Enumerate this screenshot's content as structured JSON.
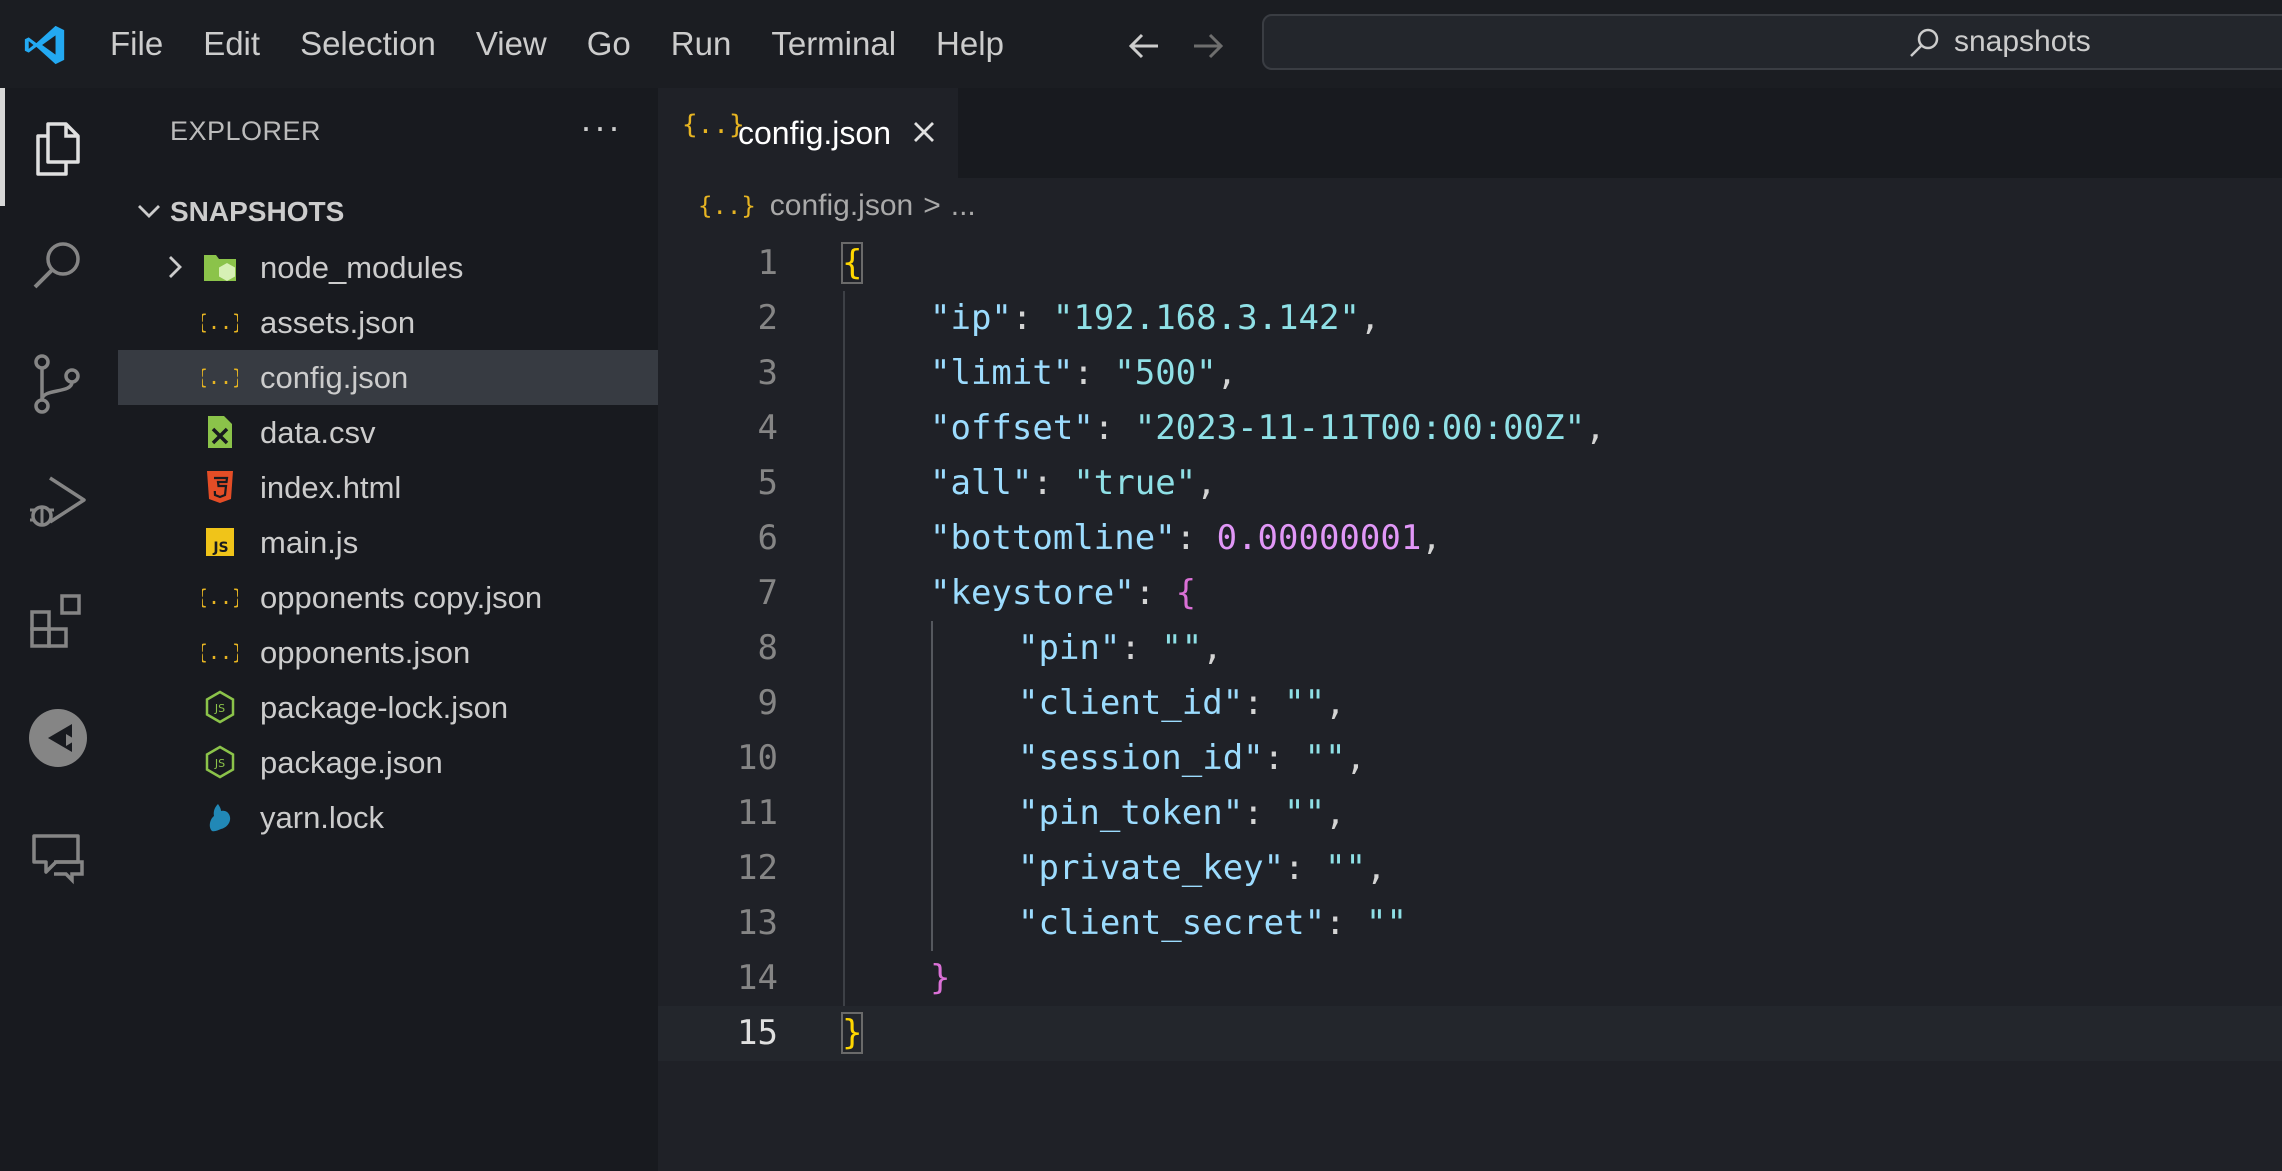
{
  "menu": {
    "items": [
      "File",
      "Edit",
      "Selection",
      "View",
      "Go",
      "Run",
      "Terminal",
      "Help"
    ]
  },
  "search": {
    "text": "snapshots"
  },
  "sidebar": {
    "title": "EXPLORER",
    "more": "···",
    "section": "SNAPSHOTS",
    "files": [
      {
        "name": "node_modules",
        "icon": "folder-node-icon",
        "type": "folder"
      },
      {
        "name": "assets.json",
        "icon": "json-icon"
      },
      {
        "name": "config.json",
        "icon": "json-icon",
        "selected": true
      },
      {
        "name": "data.csv",
        "icon": "csv-icon"
      },
      {
        "name": "index.html",
        "icon": "html5-icon"
      },
      {
        "name": "main.js",
        "icon": "js-icon"
      },
      {
        "name": "opponents copy.json",
        "icon": "json-icon"
      },
      {
        "name": "opponents.json",
        "icon": "json-icon"
      },
      {
        "name": "package-lock.json",
        "icon": "nodejs-icon"
      },
      {
        "name": "package.json",
        "icon": "nodejs-icon"
      },
      {
        "name": "yarn.lock",
        "icon": "yarn-icon"
      }
    ]
  },
  "editor": {
    "tab": {
      "label": "config.json",
      "icon_text": "{..}"
    },
    "breadcrumb": {
      "file": "config.json",
      "sep": ">",
      "rest": "...",
      "icon_text": "{..}"
    },
    "current_line": 15,
    "lines": [
      {
        "n": "1",
        "tokens": [
          [
            "b1",
            "{"
          ]
        ]
      },
      {
        "n": "2",
        "indent": 1,
        "tokens": [
          [
            "k",
            "\"ip\""
          ],
          [
            "p",
            ": "
          ],
          [
            "s",
            "\"192.168.3.142\""
          ],
          [
            "p",
            ","
          ]
        ]
      },
      {
        "n": "3",
        "indent": 1,
        "tokens": [
          [
            "k",
            "\"limit\""
          ],
          [
            "p",
            ": "
          ],
          [
            "s",
            "\"500\""
          ],
          [
            "p",
            ","
          ]
        ]
      },
      {
        "n": "4",
        "indent": 1,
        "tokens": [
          [
            "k",
            "\"offset\""
          ],
          [
            "p",
            ": "
          ],
          [
            "s",
            "\"2023-11-11T00:00:00Z\""
          ],
          [
            "p",
            ","
          ]
        ]
      },
      {
        "n": "5",
        "indent": 1,
        "tokens": [
          [
            "k",
            "\"all\""
          ],
          [
            "p",
            ": "
          ],
          [
            "s",
            "\"true\""
          ],
          [
            "p",
            ","
          ]
        ]
      },
      {
        "n": "6",
        "indent": 1,
        "tokens": [
          [
            "k",
            "\"bottomline\""
          ],
          [
            "p",
            ": "
          ],
          [
            "n",
            "0.00000001"
          ],
          [
            "p",
            ","
          ]
        ]
      },
      {
        "n": "7",
        "indent": 1,
        "tokens": [
          [
            "k",
            "\"keystore\""
          ],
          [
            "p",
            ": "
          ],
          [
            "b2",
            "{"
          ]
        ]
      },
      {
        "n": "8",
        "indent": 2,
        "tokens": [
          [
            "k",
            "\"pin\""
          ],
          [
            "p",
            ": "
          ],
          [
            "s",
            "\"\""
          ],
          [
            "p",
            ","
          ]
        ]
      },
      {
        "n": "9",
        "indent": 2,
        "tokens": [
          [
            "k",
            "\"client_id\""
          ],
          [
            "p",
            ": "
          ],
          [
            "s",
            "\"\""
          ],
          [
            "p",
            ","
          ]
        ]
      },
      {
        "n": "10",
        "indent": 2,
        "tokens": [
          [
            "k",
            "\"session_id\""
          ],
          [
            "p",
            ": "
          ],
          [
            "s",
            "\"\""
          ],
          [
            "p",
            ","
          ]
        ]
      },
      {
        "n": "11",
        "indent": 2,
        "tokens": [
          [
            "k",
            "\"pin_token\""
          ],
          [
            "p",
            ": "
          ],
          [
            "s",
            "\"\""
          ],
          [
            "p",
            ","
          ]
        ]
      },
      {
        "n": "12",
        "indent": 2,
        "tokens": [
          [
            "k",
            "\"private_key\""
          ],
          [
            "p",
            ": "
          ],
          [
            "s",
            "\"\""
          ],
          [
            "p",
            ","
          ]
        ]
      },
      {
        "n": "13",
        "indent": 2,
        "tokens": [
          [
            "k",
            "\"client_secret\""
          ],
          [
            "p",
            ": "
          ],
          [
            "s",
            "\"\""
          ]
        ]
      },
      {
        "n": "14",
        "indent": 1,
        "tokens": [
          [
            "b2",
            "}"
          ]
        ]
      },
      {
        "n": "15",
        "tokens": [
          [
            "b1",
            "}"
          ]
        ]
      }
    ]
  },
  "colors": {
    "background": "#181a1f",
    "editor_bg": "#1f2127",
    "key": "#9cdcfe",
    "string": "#8fe0e6",
    "number": "#e197f7",
    "bracket_level1": "#ffd700",
    "bracket_level2": "#da70d6",
    "vscode_blue": "#23a9f2"
  }
}
